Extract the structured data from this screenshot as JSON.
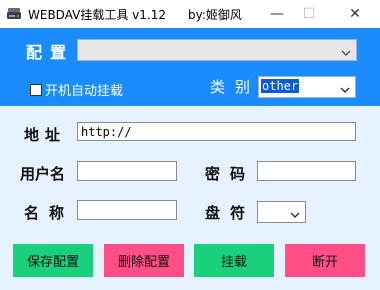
{
  "window": {
    "title": "WEBDAV挂载工具 v1.12",
    "author": "by:姬御风",
    "min_glyph": "—",
    "max_glyph": "☐",
    "close_glyph": "✕"
  },
  "config": {
    "label": "配置",
    "value": ""
  },
  "auto_mount": {
    "label": "开机自动挂载",
    "checked": false
  },
  "category": {
    "label": "类别",
    "value": "other"
  },
  "address": {
    "label": "地址",
    "value": "http://"
  },
  "username": {
    "label": "用户名",
    "value": ""
  },
  "password": {
    "label": "密码",
    "value": ""
  },
  "name": {
    "label": "名称",
    "value": ""
  },
  "drive": {
    "label": "盘符",
    "value": ""
  },
  "buttons": {
    "save": "保存配置",
    "delete": "删除配置",
    "mount": "挂载",
    "disconnect": "断开"
  },
  "colors": {
    "band": "#1a8cff",
    "save": "#19d17a",
    "delete": "#ff4f86",
    "mount": "#19d17a",
    "disconnect": "#ff4f86"
  },
  "icons": {
    "app": "drive-icon",
    "dropdown": "chevron-down-icon"
  }
}
